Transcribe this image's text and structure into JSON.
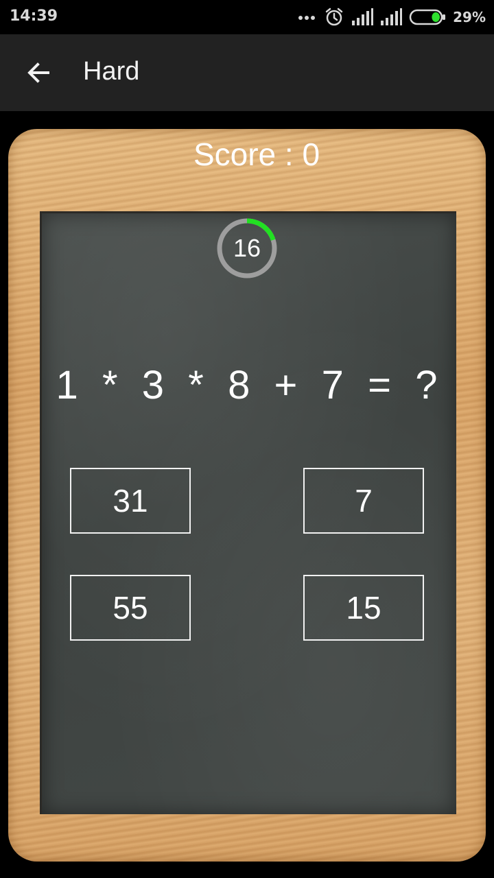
{
  "status_bar": {
    "time": "14:39",
    "battery_percent": "29%",
    "battery_level": 0.29,
    "icons": [
      "more-dots-icon",
      "alarm-icon",
      "signal-icon",
      "signal-icon",
      "battery-icon"
    ]
  },
  "app_bar": {
    "back_icon": "arrow-left-icon",
    "title": "Hard"
  },
  "game": {
    "score_label": "Score : 0",
    "timer": {
      "value": "16",
      "fraction_remaining": 0.2,
      "track_color": "#9e9e9e",
      "progress_color": "#22e022"
    },
    "question": "1  *  3  *  8  +  7  =  ?",
    "answers": [
      "31",
      "7",
      "55",
      "15"
    ]
  },
  "colors": {
    "app_bar": "#222222",
    "slate": "#434846",
    "frame_wood": "#dba66a"
  }
}
